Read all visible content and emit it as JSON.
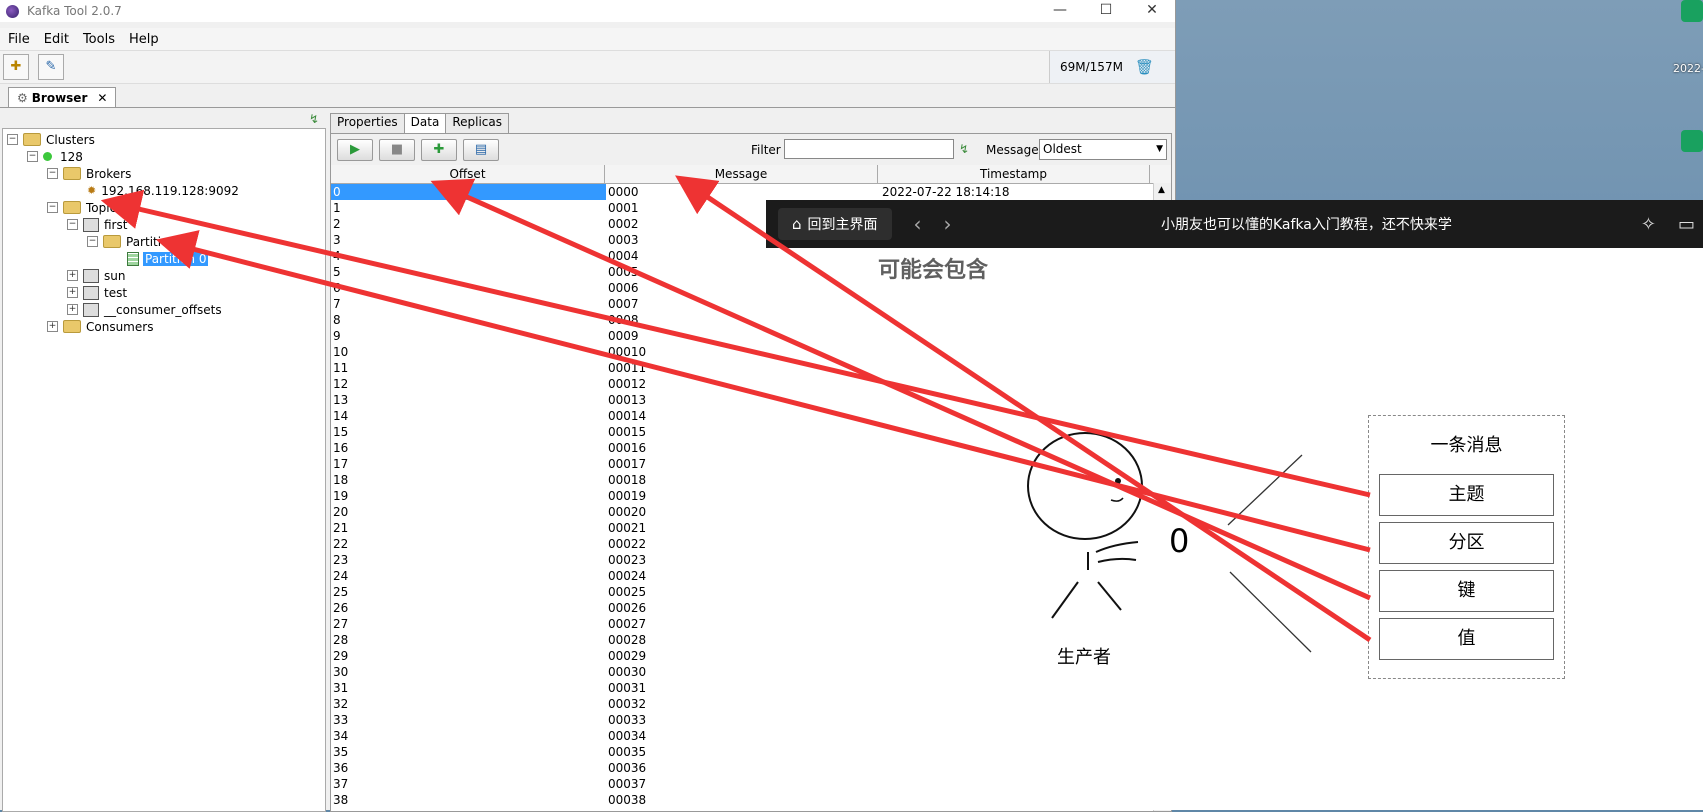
{
  "window": {
    "title": "Kafka Tool  2.0.7"
  },
  "controls": {
    "minimize": "—",
    "maximize": "☐",
    "close": "✕"
  },
  "menu": [
    "File",
    "Edit",
    "Tools",
    "Help"
  ],
  "memory": {
    "used": "69M",
    "sep": " / ",
    "total": "157M"
  },
  "browser_tab": {
    "label": "Browser",
    "close": "✕"
  },
  "tree": {
    "clusters": "Clusters",
    "cluster": "128",
    "brokers": "Brokers",
    "broker": "192.168.119.128:9092",
    "topics": "Topics",
    "topic_first": "first",
    "partitions": "Partitions",
    "partition0": "Partition 0",
    "topic_sun": "sun",
    "topic_test": "test",
    "topic_consumer": "__consumer_offsets",
    "consumers": "Consumers"
  },
  "detail_tabs": [
    "Properties",
    "Data",
    "Replicas"
  ],
  "data_toolbar": {
    "filter_label": "Filter",
    "filter_value": "",
    "messages_label": "Messages",
    "messages_value": "Oldest"
  },
  "table": {
    "columns": [
      "Offset",
      "Message",
      "Timestamp"
    ],
    "first_timestamp": "2022-07-22 18:14:18",
    "rows": [
      [
        "0",
        "0000"
      ],
      [
        "1",
        "0001"
      ],
      [
        "2",
        "0002"
      ],
      [
        "3",
        "0003"
      ],
      [
        "4",
        "0004"
      ],
      [
        "5",
        "0005"
      ],
      [
        "6",
        "0006"
      ],
      [
        "7",
        "0007"
      ],
      [
        "8",
        "0008"
      ],
      [
        "9",
        "0009"
      ],
      [
        "10",
        "00010"
      ],
      [
        "11",
        "00011"
      ],
      [
        "12",
        "00012"
      ],
      [
        "13",
        "00013"
      ],
      [
        "14",
        "00014"
      ],
      [
        "15",
        "00015"
      ],
      [
        "16",
        "00016"
      ],
      [
        "17",
        "00017"
      ],
      [
        "18",
        "00018"
      ],
      [
        "19",
        "00019"
      ],
      [
        "20",
        "00020"
      ],
      [
        "21",
        "00021"
      ],
      [
        "22",
        "00022"
      ],
      [
        "23",
        "00023"
      ],
      [
        "24",
        "00024"
      ],
      [
        "25",
        "00025"
      ],
      [
        "26",
        "00026"
      ],
      [
        "27",
        "00027"
      ],
      [
        "28",
        "00028"
      ],
      [
        "29",
        "00029"
      ],
      [
        "30",
        "00030"
      ],
      [
        "31",
        "00031"
      ],
      [
        "32",
        "00032"
      ],
      [
        "33",
        "00033"
      ],
      [
        "34",
        "00034"
      ],
      [
        "35",
        "00035"
      ],
      [
        "36",
        "00036"
      ],
      [
        "37",
        "00037"
      ],
      [
        "38",
        "00038"
      ]
    ]
  },
  "video": {
    "home_label": "回到主界面",
    "title": "小朋友也可以懂的Kafka入门教程，还不快来学",
    "subtitle": "可能会包含",
    "message_box_title": "一条消息",
    "fields": [
      "主题",
      "分区",
      "键",
      "值"
    ],
    "producer_label": "生产者",
    "zero": "0"
  },
  "desktop": {
    "label1": "2022-"
  },
  "colors": {
    "selection": "#3399ff",
    "arrow": "#ee3333",
    "video_bar": "#1b1b1b"
  }
}
